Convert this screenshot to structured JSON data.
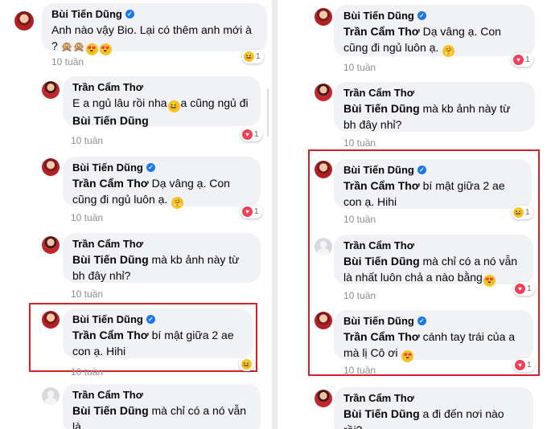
{
  "left": {
    "c1": {
      "name": "Bùi Tiến Dũng",
      "text1": "Anh nào vậy Bio. Lại có thêm anh mới à ?",
      "emojis": "🙊🙊😍😍",
      "time": "10 tuần",
      "react": "1"
    },
    "c2": {
      "name": "Trần Cẩm Thơ",
      "text_a": "E a ngủ lâu rồi nha",
      "text_b": "a cũng ngủ đi",
      "mention": "Bùi Tiến Dũng",
      "time": "10 tuần",
      "react": "1"
    },
    "c3": {
      "name": "Bùi Tiến Dũng",
      "mention": "Trần Cẩm Thơ",
      "text": " Dạ vâng ạ. Con cũng đi ngủ luôn ạ.",
      "time": "10 tuần",
      "react": "1"
    },
    "c4": {
      "name": "Trần Cẩm Thơ",
      "mention": "Bùi Tiến Dũng",
      "text": " mà kb ảnh này từ bh đây nhỉ?",
      "time": "10 tuần"
    },
    "c5": {
      "name": "Bùi Tiến Dũng",
      "mention": "Trần Cẩm Thơ",
      "text": " bí mật giữa 2 ae con ạ. Hihi",
      "time": "10 tuần"
    },
    "c6": {
      "name": "Trần Cẩm Thơ",
      "mention": "Bùi Tiến Dũng",
      "text": " mà chỉ có a nó vẫn là"
    }
  },
  "right": {
    "c1": {
      "name": "Bùi Tiến Dũng",
      "mention": "Trần Cẩm Thơ",
      "text": " Dạ vâng ạ. Con cũng đi ngủ luôn ạ.",
      "time": "10 tuần",
      "react": "1"
    },
    "c2": {
      "name": "Trần Cẩm Thơ",
      "mention": "Bùi Tiến Dũng",
      "text": " mà kb ảnh này từ bh đây nhỉ?",
      "time": "10 tuần"
    },
    "c3": {
      "name": "Bùi Tiến Dũng",
      "mention": "Trần Cẩm Thơ",
      "text": " bí mật giữa 2 ae con ạ. Hihi",
      "time": "10 tuần",
      "react": "1"
    },
    "c4": {
      "name": "Trần Cẩm Thơ",
      "mention": "Bùi Tiến Dũng",
      "text": " mà chỉ có a nó vẫn là nhất luôn chả a nào bằng",
      "time": "10 tuần",
      "react": "1"
    },
    "c5": {
      "name": "Bùi Tiến Dũng",
      "mention": "Trần Cẩm Thơ",
      "text": " cánh tay trái của a mà lị Cô ơi",
      "time": "10 tuần",
      "react": "1"
    },
    "c6": {
      "name": "Trần Cẩm Thơ",
      "mention": "Bùi Tiến Dũng",
      "text": " a đi đến nơi nào rồi?"
    }
  },
  "colors": {
    "highlight": "#d6212b",
    "bubble": "#f0f2f5",
    "meta": "#8a8d91",
    "verified": "#1877f2"
  },
  "icons": [
    "verified-badge-icon",
    "laugh-reaction-icon",
    "heart-reaction-icon",
    "heart-eyes-emoji",
    "hug-emoji",
    "laughing-emoji",
    "monkey-emoji",
    "default-avatar-icon"
  ]
}
